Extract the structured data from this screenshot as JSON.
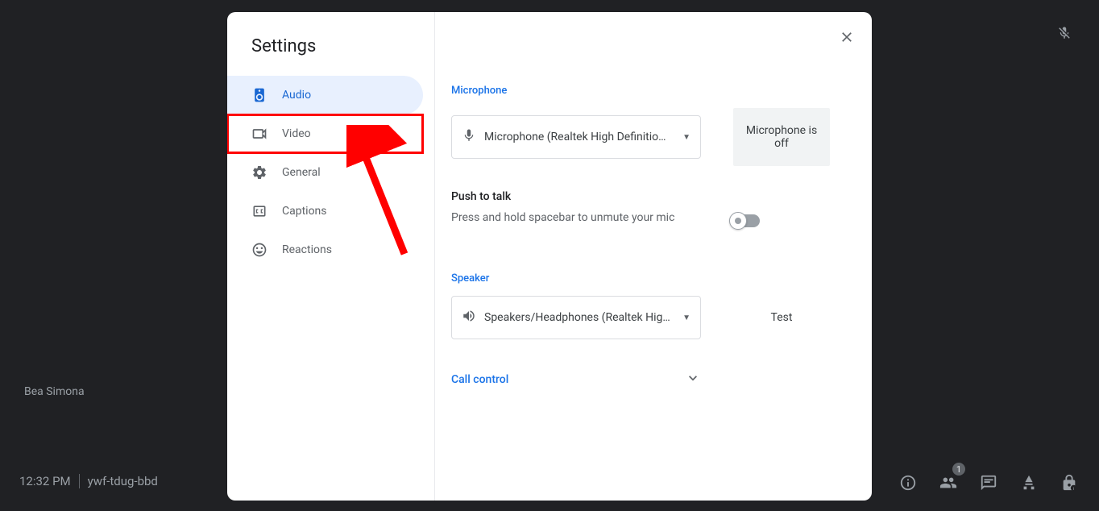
{
  "background": {
    "participant": "Bea Simona",
    "time": "12:32 PM",
    "meeting_code": "ywf-tdug-bbd",
    "people_badge": "1"
  },
  "dialog": {
    "title": "Settings",
    "nav": {
      "audio": "Audio",
      "video": "Video",
      "general": "General",
      "captions": "Captions",
      "reactions": "Reactions"
    },
    "microphone": {
      "label": "Microphone",
      "selected": "Microphone (Realtek High Definitio…",
      "status": "Microphone is off"
    },
    "push_to_talk": {
      "title": "Push to talk",
      "subtitle": "Press and hold spacebar to unmute your mic"
    },
    "speaker": {
      "label": "Speaker",
      "selected": "Speakers/Headphones (Realtek Hig…",
      "test": "Test"
    },
    "call_control": {
      "label": "Call control"
    }
  }
}
